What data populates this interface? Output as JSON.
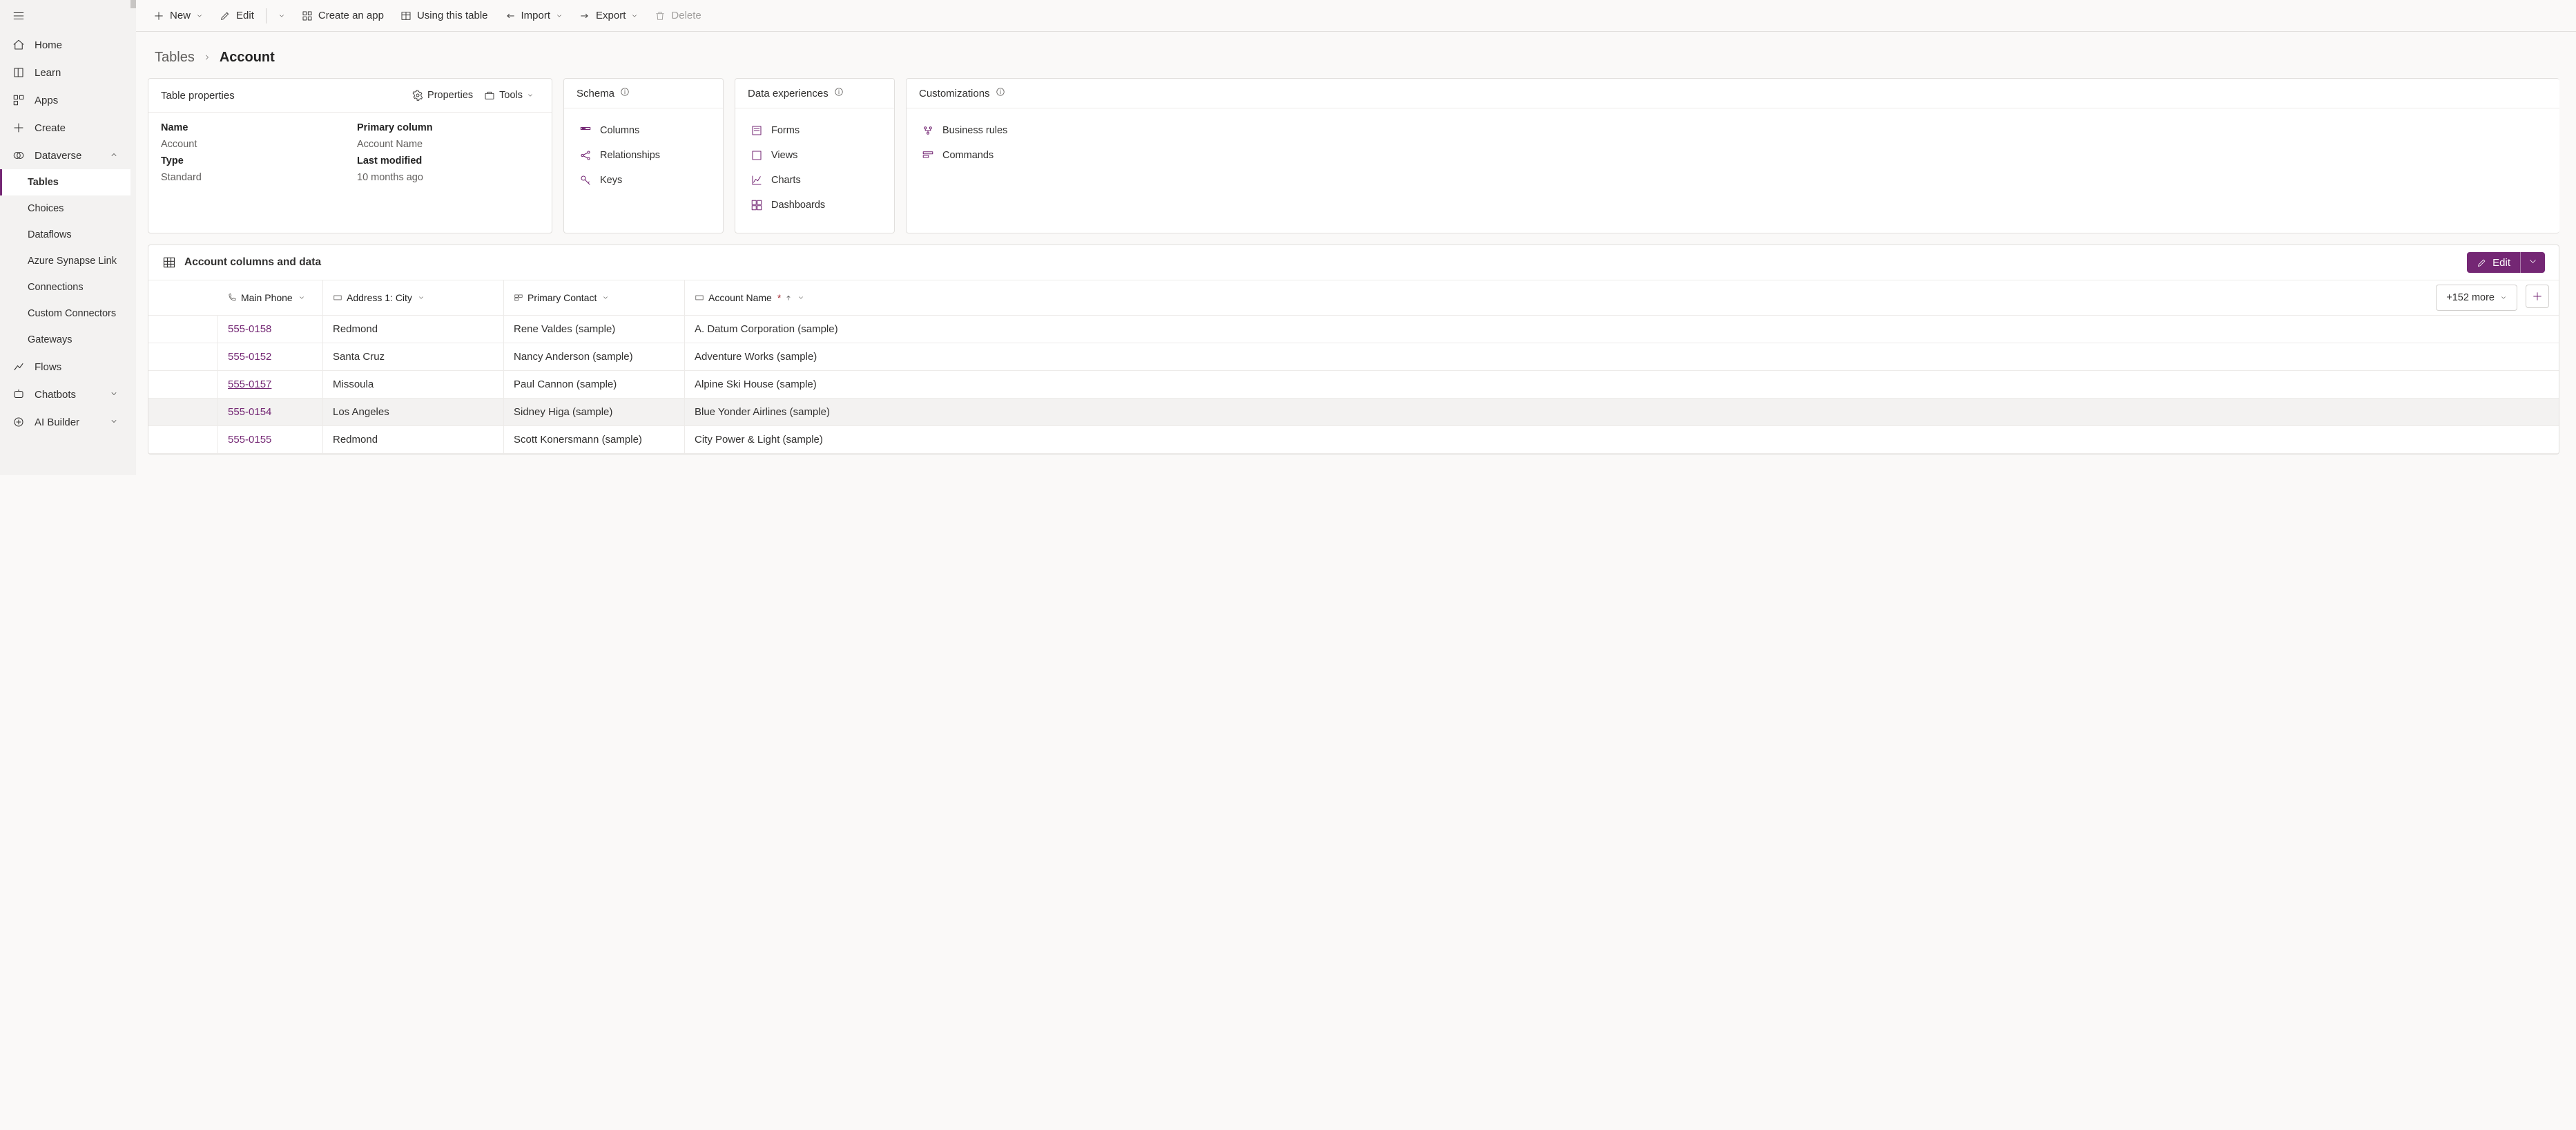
{
  "sidebar": {
    "items": [
      {
        "label": "Home"
      },
      {
        "label": "Learn"
      },
      {
        "label": "Apps"
      },
      {
        "label": "Create"
      },
      {
        "label": "Dataverse"
      },
      {
        "label": "Tables"
      },
      {
        "label": "Choices"
      },
      {
        "label": "Dataflows"
      },
      {
        "label": "Azure Synapse Link"
      },
      {
        "label": "Connections"
      },
      {
        "label": "Custom Connectors"
      },
      {
        "label": "Gateways"
      },
      {
        "label": "Flows"
      },
      {
        "label": "Chatbots"
      },
      {
        "label": "AI Builder"
      }
    ]
  },
  "toolbar": {
    "new": "New",
    "edit": "Edit",
    "create_app": "Create an app",
    "using_table": "Using this table",
    "import": "Import",
    "export": "Export",
    "delete": "Delete"
  },
  "breadcrumb": {
    "parent": "Tables",
    "current": "Account"
  },
  "cards": {
    "props": {
      "title": "Table properties",
      "properties_btn": "Properties",
      "tools_btn": "Tools",
      "name_label": "Name",
      "name_value": "Account",
      "primary_label": "Primary column",
      "primary_value": "Account Name",
      "type_label": "Type",
      "type_value": "Standard",
      "mod_label": "Last modified",
      "mod_value": "10 months ago"
    },
    "schema": {
      "title": "Schema",
      "items": [
        "Columns",
        "Relationships",
        "Keys"
      ]
    },
    "exp": {
      "title": "Data experiences",
      "items": [
        "Forms",
        "Views",
        "Charts",
        "Dashboards"
      ]
    },
    "cust": {
      "title": "Customizations",
      "items": [
        "Business rules",
        "Commands"
      ]
    }
  },
  "data_panel": {
    "title": "Account columns and data",
    "edit": "Edit",
    "more": "+152 more",
    "columns": {
      "phone": "Main Phone",
      "city": "Address 1: City",
      "contact": "Primary Contact",
      "account": "Account Name"
    },
    "rows": [
      {
        "phone": "555-0158",
        "city": "Redmond",
        "contact": "Rene Valdes (sample)",
        "account": "A. Datum Corporation (sample)"
      },
      {
        "phone": "555-0152",
        "city": "Santa Cruz",
        "contact": "Nancy Anderson (sample)",
        "account": "Adventure Works (sample)"
      },
      {
        "phone": "555-0157",
        "city": "Missoula",
        "contact": "Paul Cannon (sample)",
        "account": "Alpine Ski House (sample)"
      },
      {
        "phone": "555-0154",
        "city": "Los Angeles",
        "contact": "Sidney Higa (sample)",
        "account": "Blue Yonder Airlines (sample)"
      },
      {
        "phone": "555-0155",
        "city": "Redmond",
        "contact": "Scott Konersmann (sample)",
        "account": "City Power & Light (sample)"
      }
    ]
  }
}
